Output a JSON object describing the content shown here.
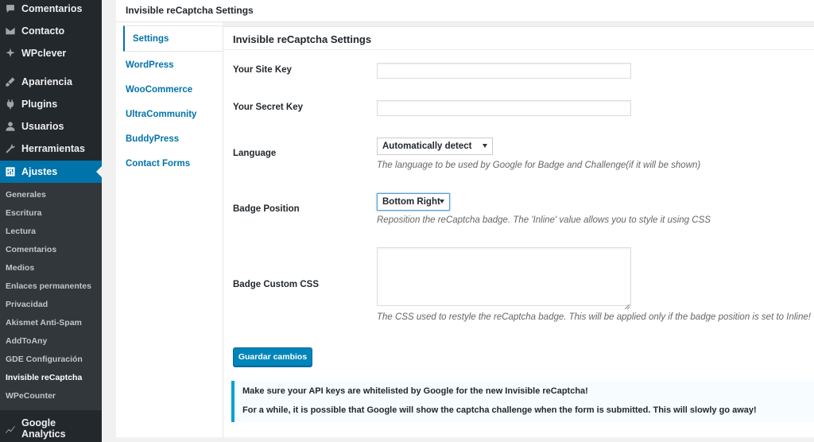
{
  "sidebar": {
    "top_items": [
      {
        "label": "Comentarios",
        "icon": "comment-icon"
      },
      {
        "label": "Contacto",
        "icon": "mail-icon"
      },
      {
        "label": "WPclever",
        "icon": "sparkle-icon"
      },
      {
        "label": "Apariencia",
        "icon": "brush-icon"
      },
      {
        "label": "Plugins",
        "icon": "plug-icon"
      },
      {
        "label": "Usuarios",
        "icon": "user-icon"
      },
      {
        "label": "Herramientas",
        "icon": "wrench-icon"
      },
      {
        "label": "Ajustes",
        "icon": "settings-icon"
      }
    ],
    "submenu": [
      "Generales",
      "Escritura",
      "Lectura",
      "Comentarios",
      "Medios",
      "Enlaces permanentes",
      "Privacidad",
      "Akismet Anti-Spam",
      "AddToAny",
      "GDE Configuración",
      "Invisible reCaptcha",
      "WPeCounter"
    ],
    "bottom_item": {
      "label": "Google Analytics",
      "icon": "chart-icon"
    }
  },
  "page": {
    "title": "Invisible reCaptcha Settings"
  },
  "tabs": [
    "Settings",
    "WordPress",
    "WooCommerce",
    "UltraCommunity",
    "BuddyPress",
    "Contact Forms"
  ],
  "form": {
    "heading": "Invisible reCaptcha Settings",
    "site_key_label": "Your Site Key",
    "site_key_value": "",
    "secret_key_label": "Your Secret Key",
    "secret_key_value": "",
    "language_label": "Language",
    "language_value": "Automatically detect",
    "language_desc": "The language to be used by Google for Badge and Challenge(if it will be shown)",
    "badge_position_label": "Badge Position",
    "badge_position_value": "Bottom Right",
    "badge_position_desc": "Reposition the reCaptcha badge. The 'Inline' value allows you to style it using CSS",
    "badge_css_label": "Badge Custom CSS",
    "badge_css_value": "",
    "badge_css_desc": "The CSS used to restyle the reCaptcha badge. This will be applied only if the badge position is set to Inline!",
    "save_label": "Guardar cambios"
  },
  "notice": {
    "line1": "Make sure your API keys are whitelisted by Google for the new Invisible reCaptcha!",
    "line2": "For a while, it is possible that Google will show the captcha challenge when the form is submitted. This will slowly go away!"
  },
  "colors": {
    "sidebar_bg": "#23282d",
    "submenu_bg": "#32373c",
    "accent": "#0073aa",
    "button": "#0085ba",
    "notice_border": "#00a0d2"
  }
}
